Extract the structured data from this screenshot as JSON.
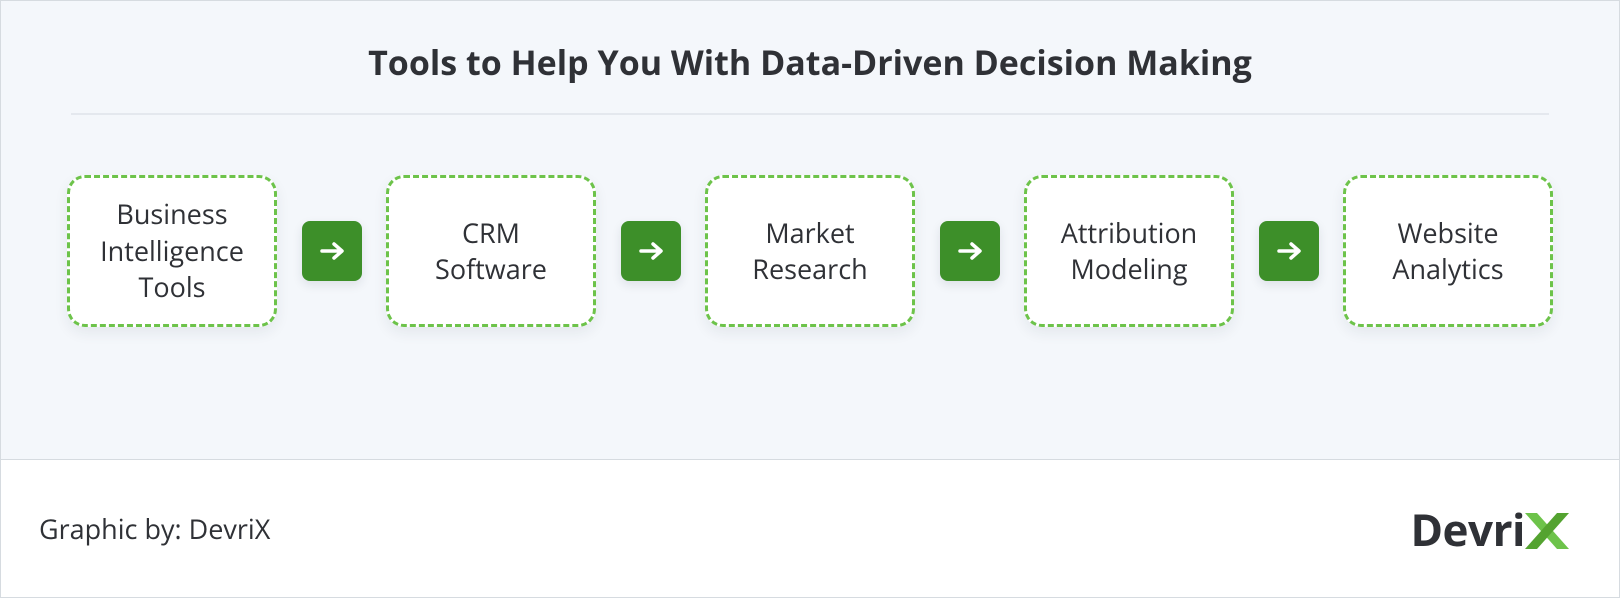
{
  "title": "Tools to Help You With Data-Driven Decision Making",
  "items": [
    "Business\nIntelligence\nTools",
    "CRM\nSoftware",
    "Market\nResearch",
    "Attribution\nModeling",
    "Website\nAnalytics"
  ],
  "footer": {
    "credit": "Graphic by: DevriX",
    "logo_text": "Devri"
  },
  "colors": {
    "card_border": "#6dc34a",
    "arrow_bg": "#3d8f29",
    "logo_x": "#6dc34a"
  }
}
